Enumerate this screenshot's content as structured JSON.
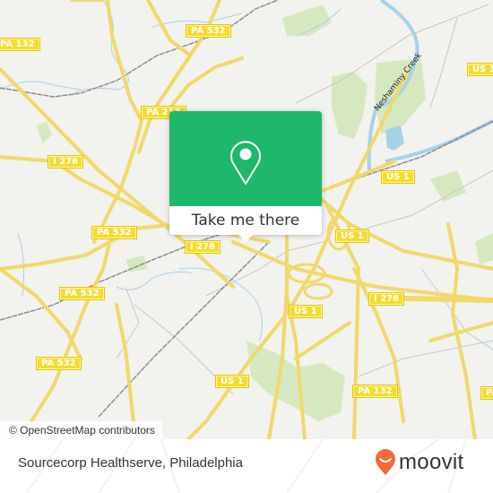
{
  "map": {
    "attribution": "© OpenStreetMap contributors",
    "water_label": "Neshaminy Creek",
    "road_shields": [
      {
        "id": "pa132-nw",
        "label": "PA 132"
      },
      {
        "id": "pa532-n",
        "label": "PA 532"
      },
      {
        "id": "pa213",
        "label": "PA 213"
      },
      {
        "id": "i276-w",
        "label": "I 276"
      },
      {
        "id": "us1-ne",
        "label": "US 1"
      },
      {
        "id": "us1-n",
        "label": "US 1"
      },
      {
        "id": "pa532-mid",
        "label": "PA 532"
      },
      {
        "id": "i276-c",
        "label": "I 276"
      },
      {
        "id": "us1-c",
        "label": "US 1"
      },
      {
        "id": "pa532-w",
        "label": "PA 532"
      },
      {
        "id": "i276-e",
        "label": "I 276"
      },
      {
        "id": "us1-s",
        "label": "US 1"
      },
      {
        "id": "pa532-sw",
        "label": "PA 532"
      },
      {
        "id": "us1-sw",
        "label": "US 1"
      },
      {
        "id": "pa132-s",
        "label": "PA 132"
      },
      {
        "id": "pa-se",
        "label": "PA"
      }
    ]
  },
  "popup": {
    "icon": "map-pin-icon",
    "action_label": "Take me there",
    "accent_color": "#1eb86a"
  },
  "footer": {
    "place_name": "Sourcecorp Healthserve, Philadelphia",
    "brand": "moovit",
    "brand_color": "#f26b3a"
  }
}
